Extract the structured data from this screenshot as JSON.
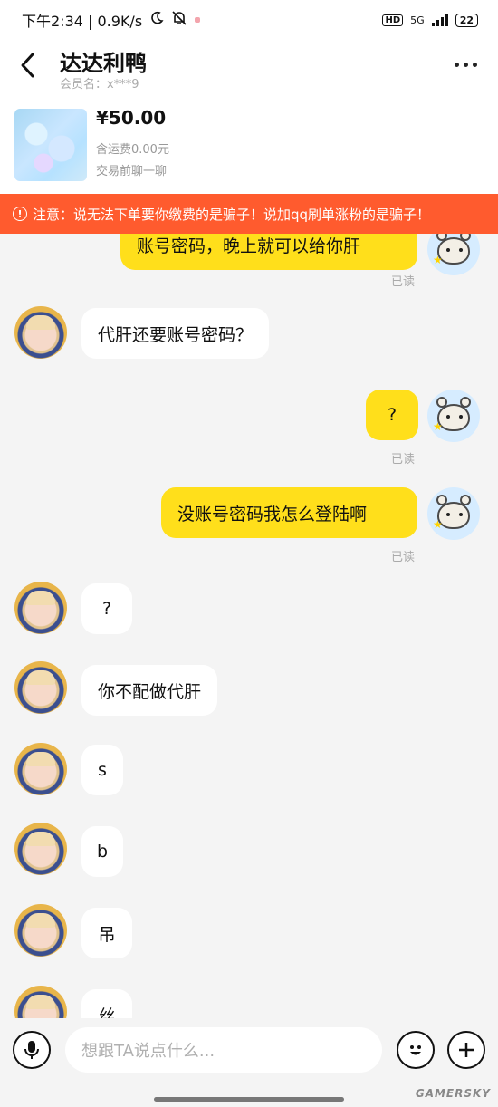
{
  "status_bar": {
    "time_speed": "下午2:34 | 0.9K/s",
    "hd": "HD",
    "network": "5G",
    "battery": "22"
  },
  "header": {
    "title": "达达利鸭",
    "member": "会员名：x***9"
  },
  "product": {
    "price": "¥50.00",
    "shipping": "含运费0.00元",
    "chat_first": "交易前聊一聊"
  },
  "warning": {
    "text": "注意：说无法下单要你缴费的是骗子！说加qq刷单涨粉的是骗子！"
  },
  "messages": [
    {
      "from": "me",
      "text": "账号密码，晚上就可以给你肝",
      "status": "已读"
    },
    {
      "from": "them",
      "text": "代肝还要账号密码？"
    },
    {
      "from": "me",
      "text": "?",
      "status": "已读"
    },
    {
      "from": "me",
      "text": "没账号密码我怎么登陆啊",
      "status": "已读"
    },
    {
      "from": "them",
      "text": "?"
    },
    {
      "from": "them",
      "text": "你不配做代肝"
    },
    {
      "from": "them",
      "text": "s"
    },
    {
      "from": "them",
      "text": "b"
    },
    {
      "from": "them",
      "text": "吊"
    },
    {
      "from": "them",
      "text": "丝"
    }
  ],
  "input": {
    "placeholder": "想跟TA说点什么..."
  },
  "watermark": "GAMERSKY",
  "colors": {
    "my_bubble": "#ffdf1b",
    "their_bubble": "#ffffff",
    "warning_bg": "#ff5b2e",
    "background": "#f4f4f4"
  },
  "icons": [
    "moon-icon",
    "bell-off-icon",
    "back-icon",
    "more-icon",
    "warning-icon",
    "mic-icon",
    "emoji-icon",
    "plus-icon"
  ]
}
